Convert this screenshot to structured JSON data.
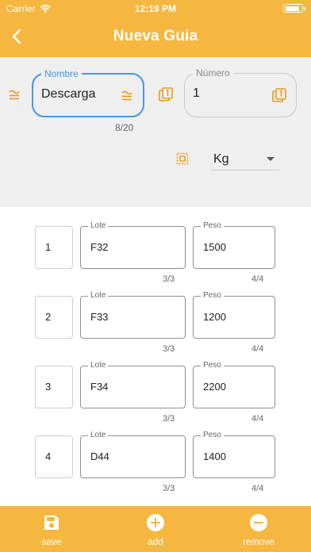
{
  "status_bar": {
    "carrier": "Carrier",
    "time": "12:19 PM"
  },
  "header": {
    "title": "Nueva Guia"
  },
  "form": {
    "nombre": {
      "label": "Nombre",
      "value": "Descarga",
      "counter": "8/20"
    },
    "numero": {
      "label": "Número",
      "value": "1"
    },
    "unit": {
      "value": "Kg"
    }
  },
  "rows": [
    {
      "index": "1",
      "lote_label": "Lote",
      "lote": "F32",
      "peso_label": "Peso",
      "peso": "1500",
      "lote_counter": "3/3",
      "peso_counter": "4/4"
    },
    {
      "index": "2",
      "lote_label": "Lote",
      "lote": "F33",
      "peso_label": "Peso",
      "peso": "1200",
      "lote_counter": "3/3",
      "peso_counter": "4/4"
    },
    {
      "index": "3",
      "lote_label": "Lote",
      "lote": "F34",
      "peso_label": "Peso",
      "peso": "2200",
      "lote_counter": "3/3",
      "peso_counter": "4/4"
    },
    {
      "index": "4",
      "lote_label": "Lote",
      "lote": "D44",
      "peso_label": "Peso",
      "peso": "1400",
      "lote_counter": "3/3",
      "peso_counter": "4/4"
    }
  ],
  "bottom_bar": {
    "save": "save",
    "add": "add",
    "remove": "remove"
  },
  "icons": {
    "back": "chevron-left-icon",
    "nombre_prefix": "approx-equal-icon",
    "nombre_suffix": "approx-equal-icon",
    "numero_prefix": "copy-one-icon",
    "numero_suffix": "copy-one-icon",
    "unit": "scale-icon",
    "save": "save-icon",
    "add": "add-circle-icon",
    "remove": "remove-circle-icon"
  },
  "colors": {
    "accent": "#f5b740",
    "icon_orange": "#e8981e",
    "focus_blue": "#4a95e8",
    "form_bg": "#efefef"
  }
}
